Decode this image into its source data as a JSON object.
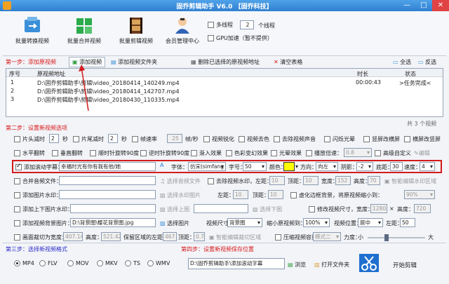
{
  "window": {
    "title": "固乔剪辑助手 V6.0  【固乔科技】",
    "minimize": "—",
    "maximize": "□",
    "close": "✕"
  },
  "toolbar": {
    "batch_convert": "批量转换视频",
    "batch_merge": "批量合并视频",
    "batch_clip": "批量剪辑视频",
    "member_center": "会员管理中心",
    "multithread_label": "多线程",
    "thread_count": "2",
    "thread_unit": "个线程",
    "gpu_label": "GPU加速（暂不提供）"
  },
  "step1": {
    "title": "第一步：添加原视频",
    "add_video": "添加视频",
    "add_folder": "添加视频文件夹",
    "delete_selected": "删除已选择的原视频地址",
    "clear_table": "清空表格",
    "select_all": "全选",
    "invert": "反选"
  },
  "table": {
    "headers": [
      "序号",
      "原视频地址",
      "时长",
      "状态"
    ],
    "rows": [
      {
        "idx": "1",
        "path": "D:\\固乔剪辑助手\\剪辑\\video_20180414_140249.mp4",
        "duration": "00:00:43",
        "status": ">任务完成<"
      },
      {
        "idx": "2",
        "path": "D:\\固乔剪辑助手\\剪辑\\video_20180414_142707.mp4",
        "duration": "",
        "status": ""
      },
      {
        "idx": "3",
        "path": "D:\\固乔剪辑助手\\剪辑\\video_20180430_110335.mp4",
        "duration": "",
        "status": ""
      }
    ],
    "count": "共 3 个视频"
  },
  "step2": {
    "title": "第二步：设置新视频选项",
    "row1": {
      "head_cut": "片头减时",
      "head_val": "2",
      "head_unit": "秒",
      "tail_cut": "片尾减时",
      "tail_val": "2",
      "tail_unit": "秒",
      "framerate": "帧速率",
      "framerate_val": "25",
      "framerate_unit": "帧/秒",
      "sharpen": "视频锐化",
      "decolor": "视频去色",
      "remove_audio": "去除视频声音",
      "flash": "闪烁光晕",
      "vertical_blur": "竖屏改横屏",
      "horizontal_blur": "横屏改竖屏"
    },
    "row2": {
      "hflip": "水平翻转",
      "vflip": "垂直翻转",
      "rot_cw": "顺时针旋转90度",
      "rot_ccw": "逆时针旋转90度",
      "fade_in": "渐入效果",
      "color_change": "色彩变幻效果",
      "light": "光晕效果",
      "speed": "播放倍速：",
      "speed_val": "0.8",
      "advanced": "高级自定义",
      "edit": "编辑"
    },
    "subtitle": {
      "label": "添加滚动字幕：",
      "text": "幸福时光有你有我有他/她",
      "font_label": "字体：",
      "font_val": "仿宋(simfang",
      "size_label": "字号：",
      "size_val": "50",
      "color_label": "颜色：",
      "dir_label": "方向：",
      "dir_val": "向左",
      "shadow_label": "阴影：",
      "shadow_val": "-2",
      "bottom_label": "底距：",
      "bottom_val": "30",
      "speed_label": "速度：",
      "speed_val": "4"
    },
    "audio": {
      "label": "合并音频文件：",
      "choose": "选择音频文件",
      "remove_wm": "去除视频水印，左距：",
      "left": "10",
      "top_label": "顶距：",
      "top": "10",
      "width_label": "宽度：",
      "width": "152",
      "height_label": "高度：",
      "height": "70",
      "smart": "智能编辑水印区域"
    },
    "image_wm": {
      "label": "添加图片水印：",
      "choose": "选择水印图片",
      "left_label": "左距：",
      "left": "10",
      "top_label": "顶距：",
      "top": "10",
      "blur": "虚化边框背景，将原视频缩小到：",
      "blur_val": "90%"
    },
    "topbottom": {
      "label": "添加上下图片水印：",
      "up": "选择上图",
      "down": "选择下图",
      "resize": "修改视频尺寸，宽度：",
      "w": "1280",
      "x": "×",
      "h_label": "高度：",
      "h": "720"
    },
    "bg": {
      "label": "添加视频背景图片：",
      "path": "D:\\背景图\\樱花背景图.jpg",
      "choose": "选择图片",
      "size_label": "视频尺寸：",
      "size_val": "背景图",
      "shrink_label": "缩小原视频到：",
      "shrink_val": "100%",
      "pos_label": "视频位置：",
      "pos_val": "居中",
      "left_label": "左距：",
      "left": "50"
    },
    "crop": {
      "label": "画面裁切为宽度：",
      "w": "407.14",
      "h_label": "高度：",
      "h": "521.42",
      "keep_left": "保留区域的左距：",
      "kl": "467",
      "top_label": "顶距：",
      "top": "0.71",
      "smart": "智能编辑裁切区域",
      "compress": "压缩视频容量",
      "mode": "模式二",
      "strength": "力度：",
      "small": "小",
      "big": "大"
    }
  },
  "step3": {
    "title": "第三步：选择新视频格式",
    "formats": [
      "MP4",
      "FLV",
      "MOV",
      "MKV",
      "TS",
      "WMV"
    ]
  },
  "step4": {
    "title": "第四步：设置新视频保存位置",
    "path": "D:\\固乔剪辑助手\\添加滚动字幕",
    "browse": "浏览",
    "open_folder": "打开文件夹",
    "start": "开始剪辑"
  },
  "colors": {
    "accent": "#2f7fd0",
    "step_title": "#d81818",
    "subtitle_color": "#ffff00",
    "highlight_border": "#d31b1b"
  }
}
